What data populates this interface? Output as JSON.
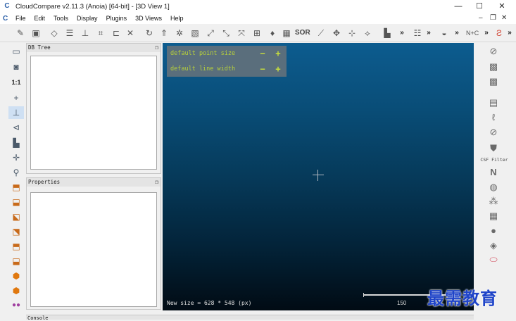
{
  "window": {
    "app_icon": "C",
    "title": "CloudCompare v2.11.3 (Anoia) [64-bit] - [3D View 1]",
    "minimize": "—",
    "maximize": "☐",
    "close": "✕"
  },
  "menubar": {
    "logo": "C",
    "items": [
      "File",
      "Edit",
      "Tools",
      "Display",
      "Plugins",
      "3D Views",
      "Help"
    ],
    "mdi_minimize": "–",
    "mdi_restore": "❐",
    "mdi_close": "✕"
  },
  "toolbar": {
    "sor_label": "SOR",
    "more": "»"
  },
  "left_tools": {
    "one_to_one": "1:1"
  },
  "db_tree": {
    "title": "DB Tree",
    "float": "❐"
  },
  "properties": {
    "title": "Properties",
    "float": "❐"
  },
  "view3d": {
    "hot_zone": {
      "point_size_label": "default point size",
      "line_width_label": "default line width",
      "minus": "−",
      "plus": "+"
    },
    "status_message": "New size = 628 * 548 (px)",
    "scale_label": "150"
  },
  "right_tools": {
    "csf_label": "CSF Filter"
  },
  "console": {
    "title": "Console"
  },
  "watermark": "最需教育",
  "colors": {
    "hot_zone_text": "#b8d13a",
    "view_top": "#0d5c8f",
    "view_bottom": "#010b14",
    "watermark": "#1f44c8"
  }
}
